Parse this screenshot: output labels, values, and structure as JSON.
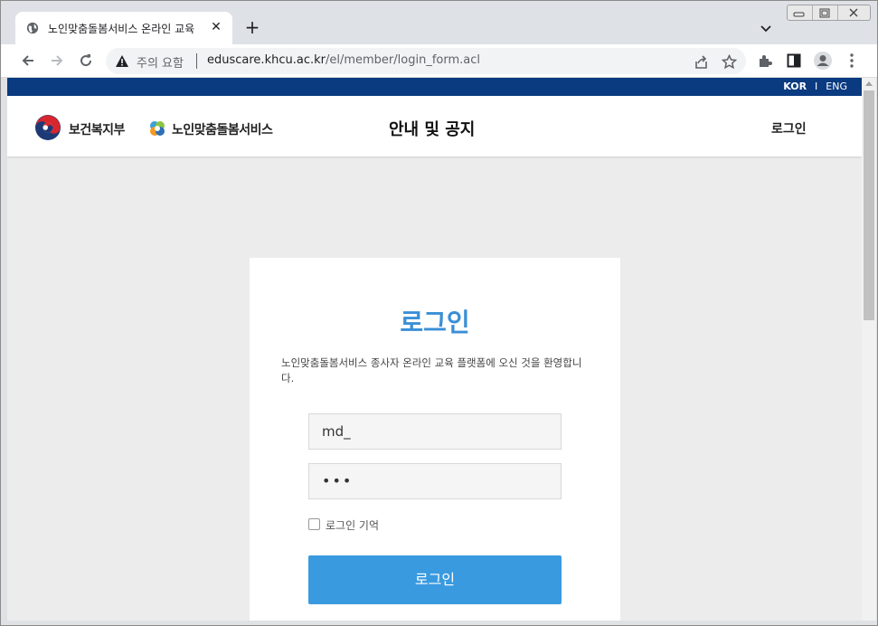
{
  "browser": {
    "tab_title": "노인맞춤돌봄서비스 온라인 교육",
    "tab_close": "✕",
    "new_tab": "+",
    "security_warning": "주의 요함",
    "url_host": "eduscare.khcu.ac.kr",
    "url_path": "/el/member/login_form.acl",
    "icons": [
      "globe-icon",
      "close-icon",
      "plus-icon",
      "chevron-down-icon",
      "back-icon",
      "forward-icon",
      "reload-icon",
      "warning-icon",
      "share-icon",
      "star-icon",
      "extensions-icon",
      "side-panel-icon",
      "profile-icon",
      "menu-icon"
    ]
  },
  "site": {
    "lang_kor": "KOR",
    "lang_sep": "I",
    "lang_eng": "ENG",
    "logo_mohw": "보건복지부",
    "logo_service": "노인맞춤돌봄서비스",
    "nav_notice": "안내 및 공지",
    "nav_login": "로그인",
    "topbar_color": "#0a3a80"
  },
  "login": {
    "title": "로그인",
    "welcome": "노인맞춤돌봄서비스 종사자 온라인 교육 플랫폼에 오신 것을 환영합니다.",
    "id_value": "md_",
    "password_value": "•••",
    "remember_label": "로그인 기억",
    "remember_checked": false,
    "button_label": "로그인",
    "accent_color": "#3a9ae0"
  }
}
